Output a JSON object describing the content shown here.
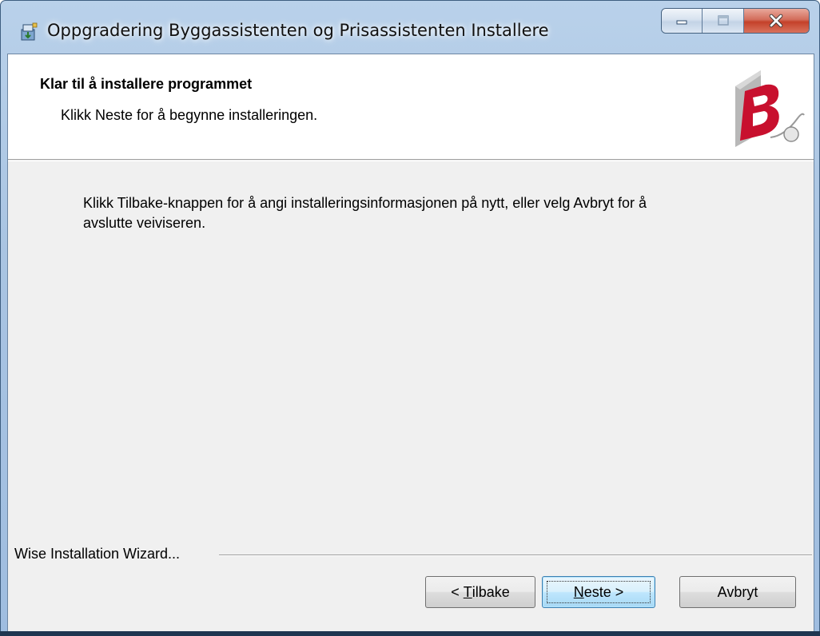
{
  "window": {
    "title": "Oppgradering Byggassistenten og Prisassistenten Installere",
    "icon": "installer-icon",
    "caption_buttons": [
      "minimize-icon",
      "maximize-icon",
      "close-icon"
    ]
  },
  "header": {
    "title": "Klar til å installere programmet",
    "subtitle": "Klikk Neste for å begynne installeringen.",
    "logo": "bygg-logo"
  },
  "body": {
    "text": "Klikk Tilbake-knappen for å angi installeringsinformasjonen på nytt, eller velg Avbryt for å avslutte veiviseren."
  },
  "branding": {
    "text": "Wise Installation Wizard..."
  },
  "buttons": {
    "back": {
      "prefix": "< ",
      "accel": "T",
      "rest": "ilbake"
    },
    "next": {
      "accel": "N",
      "rest": "este >"
    },
    "cancel": "Avbryt"
  },
  "colors": {
    "header_bg": "#ffffff",
    "dialog_bg": "#f0f0f0",
    "close_button": "#c4412a",
    "logo_red": "#c8102e"
  }
}
